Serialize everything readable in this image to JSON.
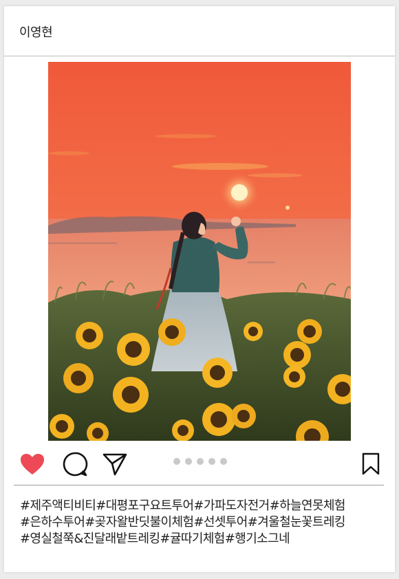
{
  "post": {
    "username": "이영현",
    "photo_alt": "sunset-sunflower-hanbok-photo",
    "carousel_dot_count": 5,
    "liked": true,
    "colors": {
      "like": "#ed4956",
      "dot": "#c9c9c9",
      "text": "#222222"
    },
    "icons": [
      "heart-icon",
      "comment-icon",
      "share-icon",
      "bookmark-icon"
    ],
    "caption_lines": [
      "#제주액티비티#대평포구요트투어#가파도자전거#하늘연못체험",
      "#은하수투어#곶자왈반딧불이체험#선셋투어#겨울철눈꽃트레킹",
      "#영실철쭉&진달래밭트레킹#귤따기체험#행기소그네"
    ]
  }
}
